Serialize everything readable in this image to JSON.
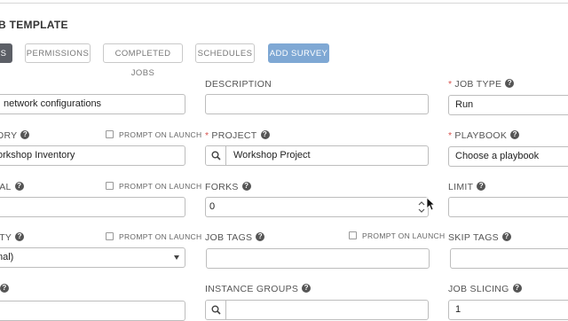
{
  "header": {
    "title": "B TEMPLATE"
  },
  "tabs": [
    {
      "label": "S"
    },
    {
      "label": "PERMISSIONS"
    },
    {
      "label": "COMPLETED JOBS"
    },
    {
      "label": "SCHEDULES"
    },
    {
      "label": "ADD SURVEY"
    }
  ],
  "prompt_on_launch": "PROMPT ON LAUNCH",
  "form": {
    "name": {
      "value": "network configurations"
    },
    "description": {
      "label": "DESCRIPTION",
      "value": ""
    },
    "job_type": {
      "label": "JOB TYPE",
      "value": "Run"
    },
    "inventory": {
      "label": "ORY",
      "value": "orkshop Inventory"
    },
    "project": {
      "label": "PROJECT",
      "value": "Workshop Project"
    },
    "playbook": {
      "label": "PLAYBOOK",
      "value": "Choose a playbook"
    },
    "credential": {
      "label": "IAL",
      "value": ""
    },
    "forks": {
      "label": "FORKS",
      "value": "0"
    },
    "limit": {
      "label": "LIMIT",
      "value": ""
    },
    "verbosity": {
      "label": "ITY",
      "value": "nal)"
    },
    "job_tags": {
      "label": "JOB TAGS",
      "value": ""
    },
    "skip_tags": {
      "label": "SKIP TAGS",
      "value": ""
    },
    "instance_groups": {
      "label": "INSTANCE GROUPS",
      "value": ""
    },
    "job_slicing": {
      "label": "JOB SLICING",
      "value": "1"
    }
  },
  "colors": {
    "required": "#d9534f",
    "add_survey": "#7fa8d4",
    "active_tab": "#5c5f66"
  },
  "icons": {
    "help": "question-circle-icon",
    "search": "search-icon",
    "select": "chevron-down-icon",
    "cursor": "mouse-pointer-icon"
  }
}
